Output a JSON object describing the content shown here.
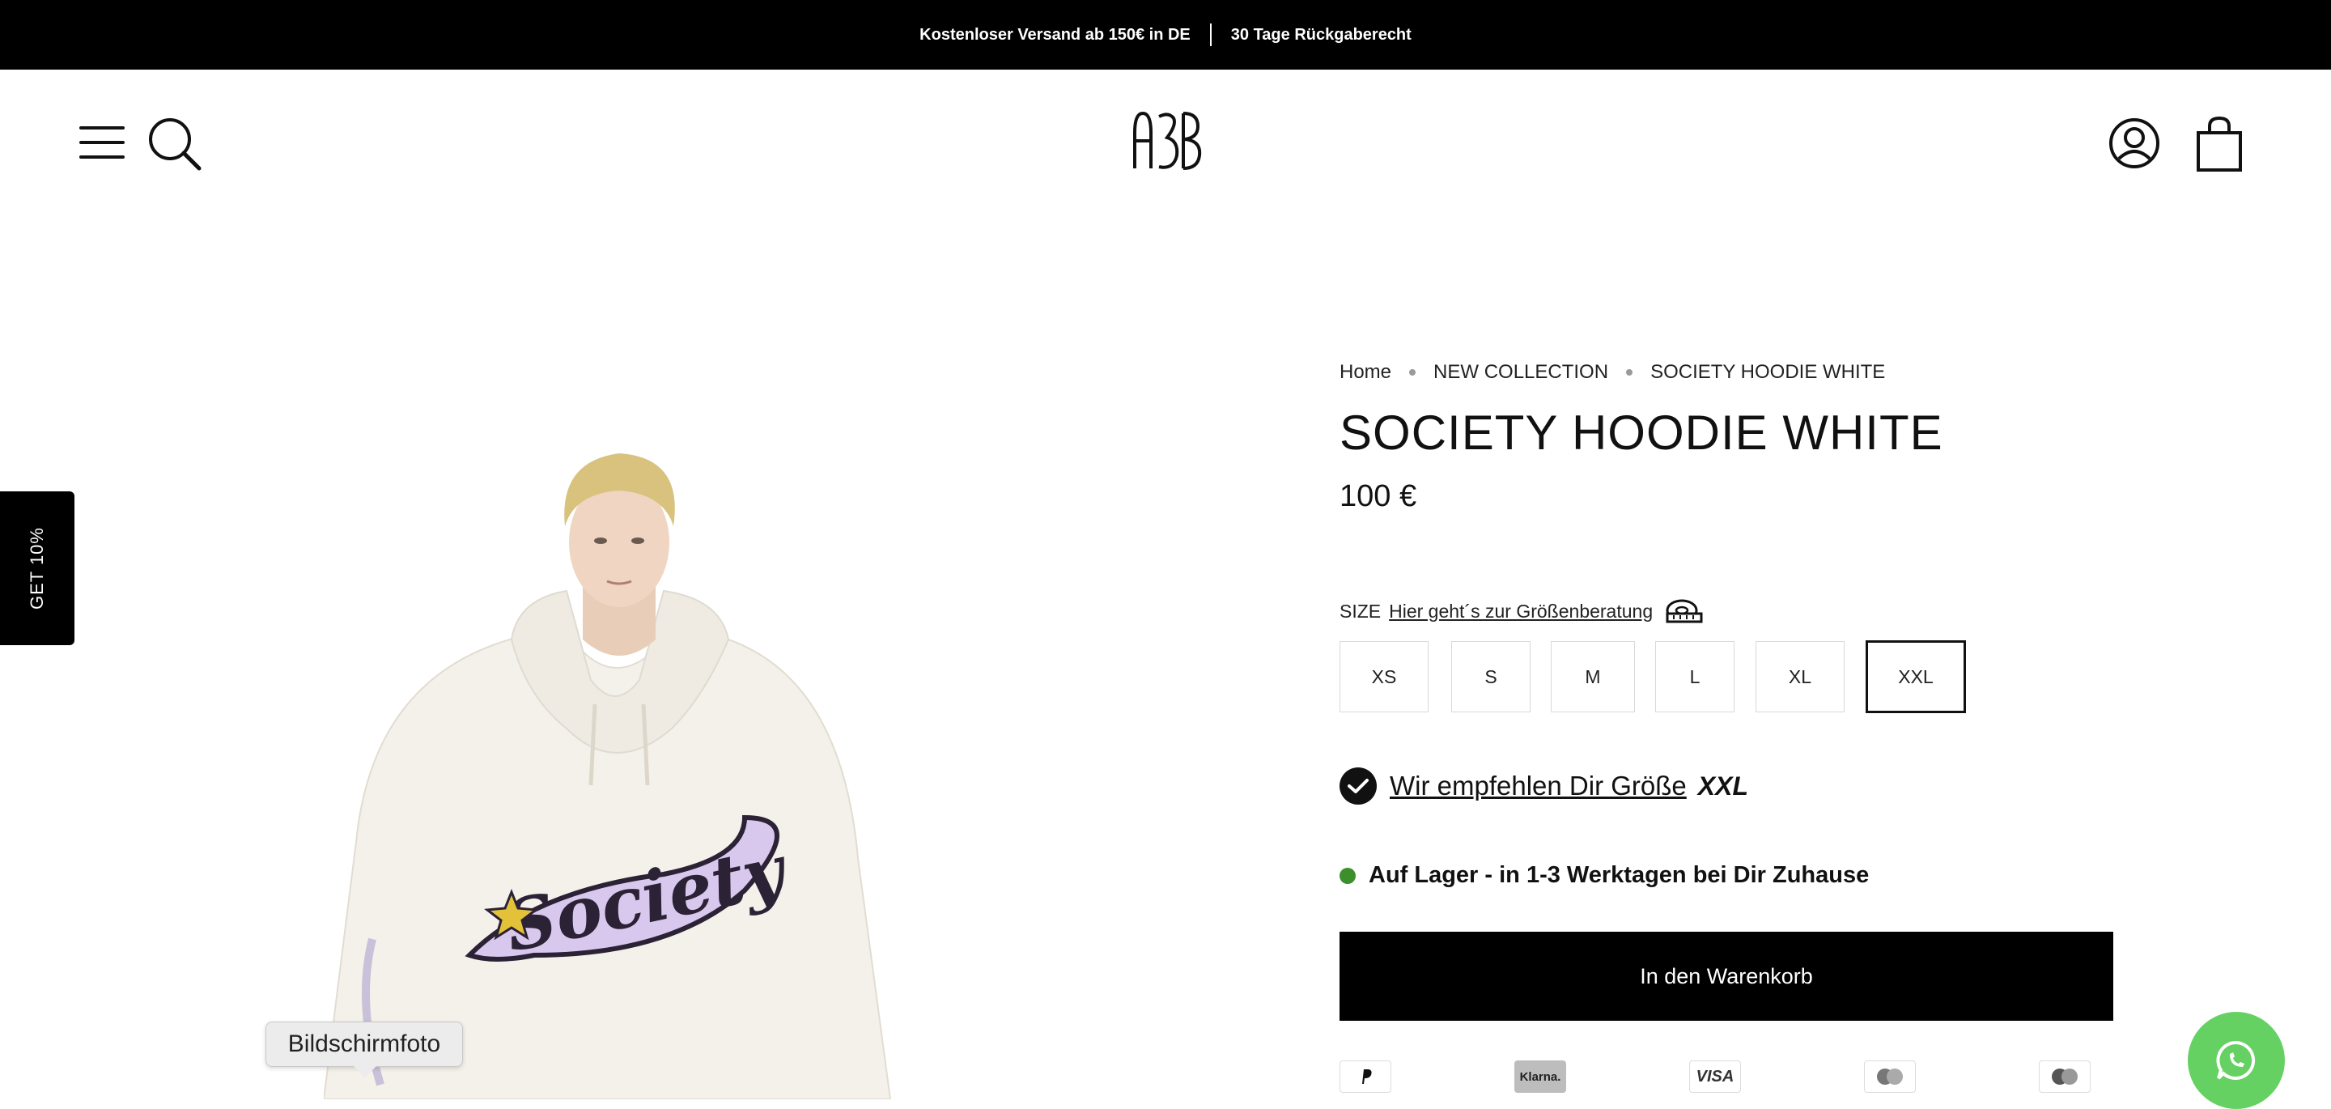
{
  "announcement": {
    "shipping": "Kostenloser Versand ab 150€ in DE",
    "returns": "30 Tage Rückgaberecht"
  },
  "header": {
    "logo_text": "A3B",
    "icons": [
      "menu-icon",
      "search-icon",
      "account-icon",
      "cart-icon"
    ]
  },
  "side_tab": {
    "label": "GET 10%"
  },
  "breadcrumb": [
    "Home",
    "NEW COLLECTION",
    "SOCIETY HOODIE WHITE"
  ],
  "product": {
    "title": "SOCIETY HOODIE WHITE",
    "price": "100 €",
    "hoodie_print": "Society"
  },
  "size": {
    "label": "SIZE",
    "guide_link": "Hier geht´s zur Größenberatung",
    "options": [
      "XS",
      "S",
      "M",
      "L",
      "XL",
      "XXL"
    ],
    "selected": "XXL"
  },
  "recommendation": {
    "text": "Wir empfehlen Dir Größe",
    "size": "XXL"
  },
  "stock": {
    "text": "Auf Lager - in 1-3 Werktagen bei Dir Zuhause",
    "color": "#3d8f2c"
  },
  "add_to_cart": "In den Warenkorb",
  "payments": [
    "PayPal",
    "Klarna.",
    "VISA",
    "Maestro",
    "Mastercard"
  ],
  "tooltip": "Bildschirmfoto",
  "colors": {
    "accent": "#000000",
    "whatsapp": "#66d163",
    "stock_dot": "#3d8f2c"
  }
}
